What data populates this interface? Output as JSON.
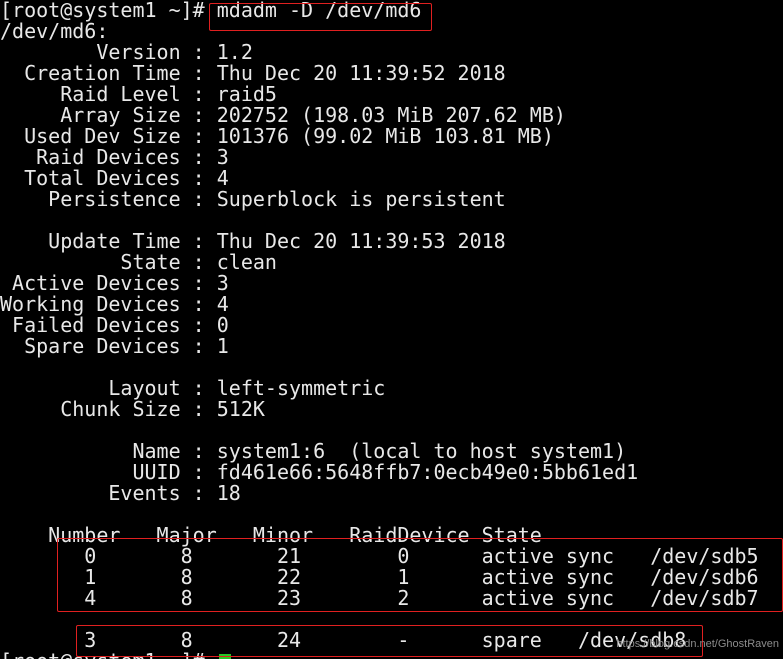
{
  "terminal": {
    "prompt1": "[root@system1 ~]# ",
    "command": "mdadm -D /dev/md6",
    "device": "/dev/md6:",
    "info": [
      "        Version : 1.2",
      "  Creation Time : Thu Dec 20 11:39:52 2018",
      "     Raid Level : raid5",
      "     Array Size : 202752 (198.03 MiB 207.62 MB)",
      "  Used Dev Size : 101376 (99.02 MiB 103.81 MB)",
      "   Raid Devices : 3",
      "  Total Devices : 4",
      "    Persistence : Superblock is persistent",
      "",
      "    Update Time : Thu Dec 20 11:39:53 2018",
      "          State : clean",
      " Active Devices : 3",
      "Working Devices : 4",
      " Failed Devices : 0",
      "  Spare Devices : 1",
      "",
      "         Layout : left-symmetric",
      "     Chunk Size : 512K",
      "",
      "           Name : system1:6  (local to host system1)",
      "           UUID : fd461e66:5648ffb7:0ecb49e0:5bb61ed1",
      "         Events : 18",
      ""
    ],
    "table_header": "    Number   Major   Minor   RaidDevice State",
    "active_rows": [
      "       0       8       21        0      active sync   /dev/sdb5",
      "       1       8       22        1      active sync   /dev/sdb6",
      "       4       8       23        2      active sync   /dev/sdb7"
    ],
    "blank": "",
    "spare_row": "       3       8       24        -      spare   /dev/sdb8",
    "prompt2": "[root@system1 ~]# "
  },
  "watermark": "https://blog.csdn.net/GhostRaven",
  "colors": {
    "background": "#000000",
    "text": "#e8e8e8",
    "cursor": "#24c824",
    "highlight_border": "#e02020"
  }
}
